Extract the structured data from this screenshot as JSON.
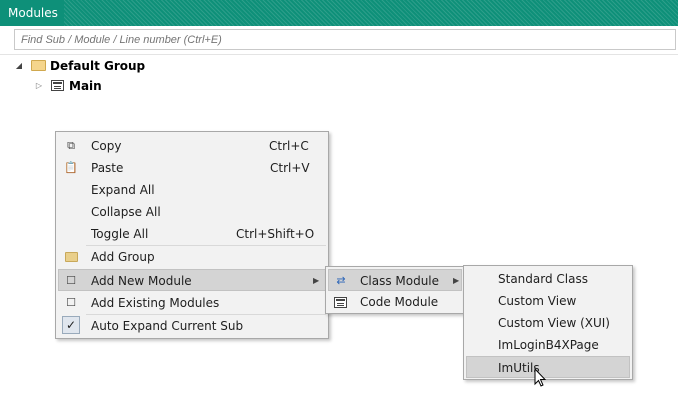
{
  "window": {
    "title": "Modules"
  },
  "search": {
    "placeholder": "Find Sub / Module / Line number (Ctrl+E)"
  },
  "tree": {
    "group": {
      "label": "Default Group",
      "expanded": true
    },
    "items": [
      {
        "label": "Main",
        "expanded": false
      }
    ]
  },
  "context_menu": {
    "items": [
      {
        "label": "Copy",
        "shortcut": "Ctrl+C",
        "icon": "copy-icon"
      },
      {
        "label": "Paste",
        "shortcut": "Ctrl+V",
        "icon": "paste-icon"
      },
      {
        "label": "Expand All",
        "shortcut": ""
      },
      {
        "label": "Collapse All",
        "shortcut": ""
      },
      {
        "label": "Toggle All",
        "shortcut": "Ctrl+Shift+O"
      },
      {
        "label": "Add Group",
        "icon": "folder-icon"
      },
      {
        "label": "Add New Module",
        "icon": "new-module-icon",
        "submenu": true,
        "highlighted": true
      },
      {
        "label": "Add Existing Modules",
        "icon": "add-existing-icon"
      },
      {
        "label": "Auto Expand Current Sub",
        "checked": true
      }
    ]
  },
  "submenu_1": {
    "items": [
      {
        "label": "Class Module",
        "icon": "class-module-icon",
        "submenu": true,
        "highlighted": true
      },
      {
        "label": "Code Module",
        "icon": "code-module-icon"
      }
    ]
  },
  "submenu_2": {
    "items": [
      {
        "label": "Standard Class"
      },
      {
        "label": "Custom View"
      },
      {
        "label": "Custom View (XUI)"
      },
      {
        "label": "ImLoginB4XPage"
      },
      {
        "label": "ImUtils",
        "highlighted": true
      }
    ]
  },
  "colors": {
    "titlebar": "#0e9079",
    "menu_background": "#f2f2f2",
    "menu_highlight": "#d4d4d4"
  }
}
